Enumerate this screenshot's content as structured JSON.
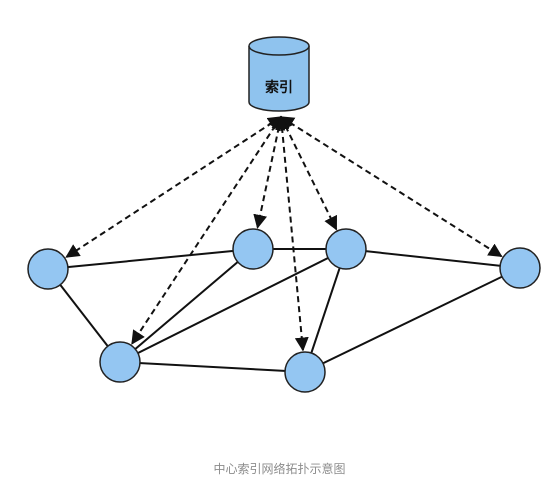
{
  "index": {
    "label": "索引"
  },
  "caption": "中心索引网络拓扑示意图",
  "colors": {
    "node_fill": "#94c6f2",
    "node_stroke": "#222222",
    "db_fill": "#8fc3ee",
    "line": "#111111"
  },
  "nodes": [
    {
      "id": "n1"
    },
    {
      "id": "n2"
    },
    {
      "id": "n3"
    },
    {
      "id": "n4"
    },
    {
      "id": "n5"
    },
    {
      "id": "n6"
    },
    {
      "id": "n7"
    }
  ],
  "solid_links": [
    {
      "from": "n1",
      "to": "n2"
    },
    {
      "from": "n1",
      "to": "n5"
    },
    {
      "from": "n2",
      "to": "n3"
    },
    {
      "from": "n2",
      "to": "n5"
    },
    {
      "from": "n3",
      "to": "n5"
    },
    {
      "from": "n3",
      "to": "n4"
    },
    {
      "from": "n3",
      "to": "n6"
    },
    {
      "from": "n5",
      "to": "n6"
    },
    {
      "from": "n6",
      "to": "n4"
    }
  ],
  "index_links": [
    "n1",
    "n2",
    "n3",
    "n4",
    "n5",
    "n6"
  ]
}
